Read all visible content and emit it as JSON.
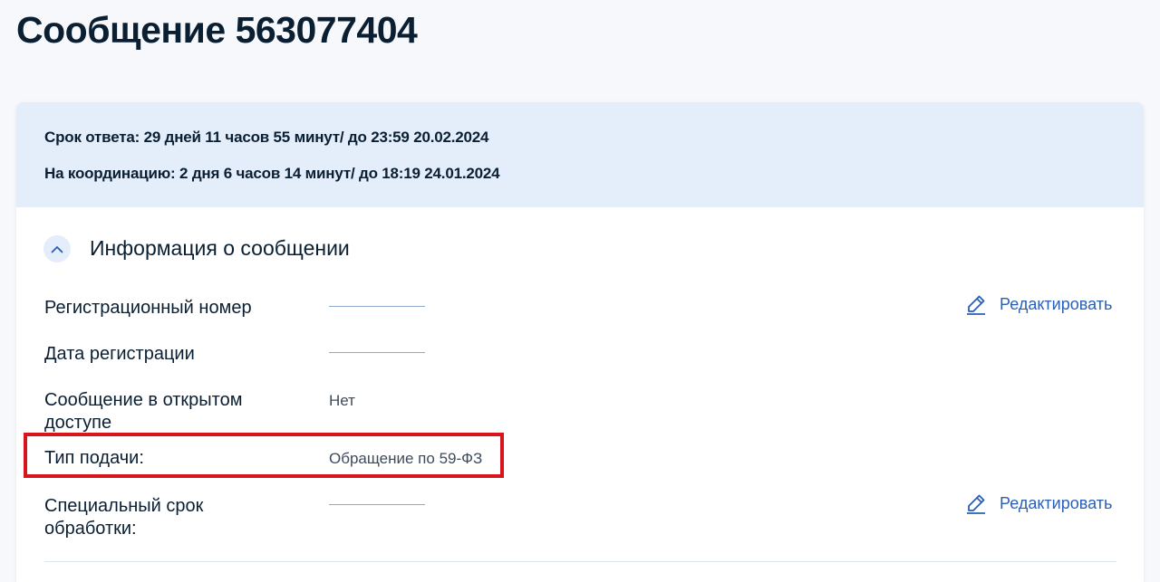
{
  "page": {
    "title": "Сообщение 563077404"
  },
  "deadlines": {
    "response": "Срок ответа: 29 дней 11 часов 55 минут/ до 23:59 20.02.2024",
    "coordination": "На координацию: 2 дня 6 часов 14 минут/ до 18:19 24.01.2024"
  },
  "section": {
    "title": "Информация о сообщении",
    "toggle_icon": "chevron-up-icon",
    "expanded": true
  },
  "fields": {
    "reg_number": {
      "label": "Регистрационный номер",
      "value": ""
    },
    "reg_date": {
      "label": "Дата регистрации",
      "value": ""
    },
    "public": {
      "label": "Сообщение в открытом доступе",
      "value": "Нет"
    },
    "submission_type": {
      "label": "Тип подачи:",
      "value": "Обращение по 59-ФЗ",
      "highlighted": true
    },
    "special_deadline": {
      "label": "Специальный срок обработки:",
      "value": ""
    }
  },
  "actions": {
    "edit_label": "Редактировать",
    "edit_icon": "pencil-icon"
  },
  "colors": {
    "accent": "#2a5fb5",
    "banner_bg": "#e4edfa",
    "highlight": "#d8141c",
    "text": "#0b1f33"
  }
}
